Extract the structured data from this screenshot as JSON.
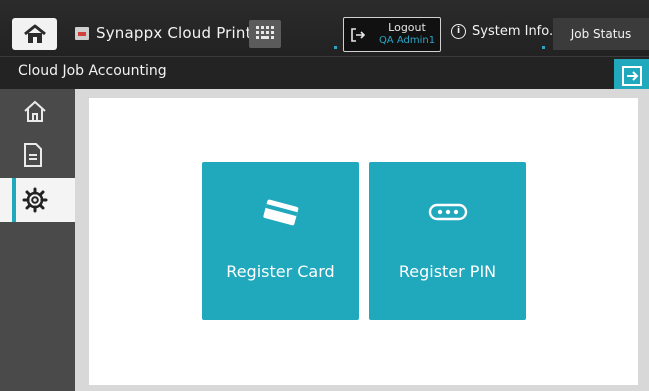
{
  "header": {
    "app_title": "Synappx Cloud Print",
    "logout": {
      "label": "Logout",
      "user": "QA Admin1"
    },
    "system_info_label": "System Info.",
    "job_status_label": "Job Status"
  },
  "titlebar": {
    "title": "Cloud Job Accounting"
  },
  "sidebar": {
    "items": [
      {
        "icon": "home-icon",
        "active": false
      },
      {
        "icon": "document-icon",
        "active": false
      },
      {
        "icon": "settings-gear-icon",
        "active": true
      }
    ]
  },
  "main": {
    "tiles": [
      {
        "label": "Register Card",
        "icon": "card-icon"
      },
      {
        "label": "Register PIN",
        "icon": "pin-icon"
      }
    ]
  },
  "colors": {
    "accent": "#20a8bd",
    "dark_bg": "#1e1e1e",
    "sidebar_bg": "#4a4a4a"
  }
}
